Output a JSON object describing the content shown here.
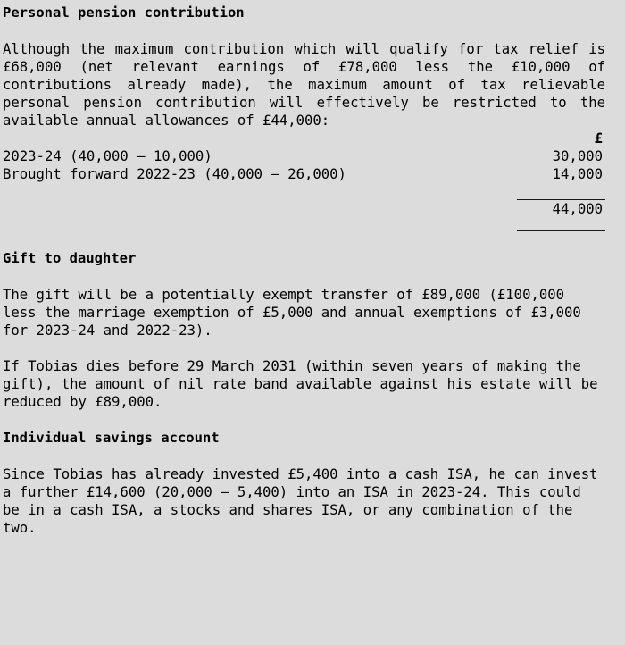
{
  "document": {
    "sections": [
      {
        "heading": "Personal pension contribution",
        "paragraphs": [
          "Although the maximum contribution which will qualify for tax relief is £68,000 (net relevant earnings of £78,000 less the £10,000 of contributions already made), the maximum amount of tax relievable personal pension contribution will effectively be restricted to the available annual allowances of £44,000:"
        ],
        "table": {
          "currency_symbol": "£",
          "rows": [
            {
              "label": "2023-24 (40,000 – 10,000)",
              "amount": "30,000"
            },
            {
              "label": "Brought forward 2022-23 (40,000 – 26,000)",
              "amount": "14,000"
            }
          ],
          "total": {
            "label": "",
            "amount": "44,000"
          }
        }
      },
      {
        "heading": "Gift to daughter",
        "paragraphs": [
          "The gift will be a potentially exempt transfer of £89,000 (£100,000 less the marriage exemption of £5,000 and annual exemptions of £3,000 for 2023-24 and 2022-23).",
          "If Tobias dies before 29 March 2031 (within seven years of making the gift), the amount of nil rate band available against his estate will be reduced by £89,000."
        ]
      },
      {
        "heading": "Individual savings account",
        "paragraphs": [
          "Since Tobias has already invested £5,400 into a cash ISA, he can invest a further £14,600 (20,000 – 5,400) into an ISA in 2023-24. This could be in a cash ISA, a stocks and shares ISA, or any combination of the two."
        ]
      }
    ]
  },
  "style": {
    "background_color": "#dcdcdc",
    "text_color": "#000000",
    "rule_color": "#1a1a1a"
  }
}
